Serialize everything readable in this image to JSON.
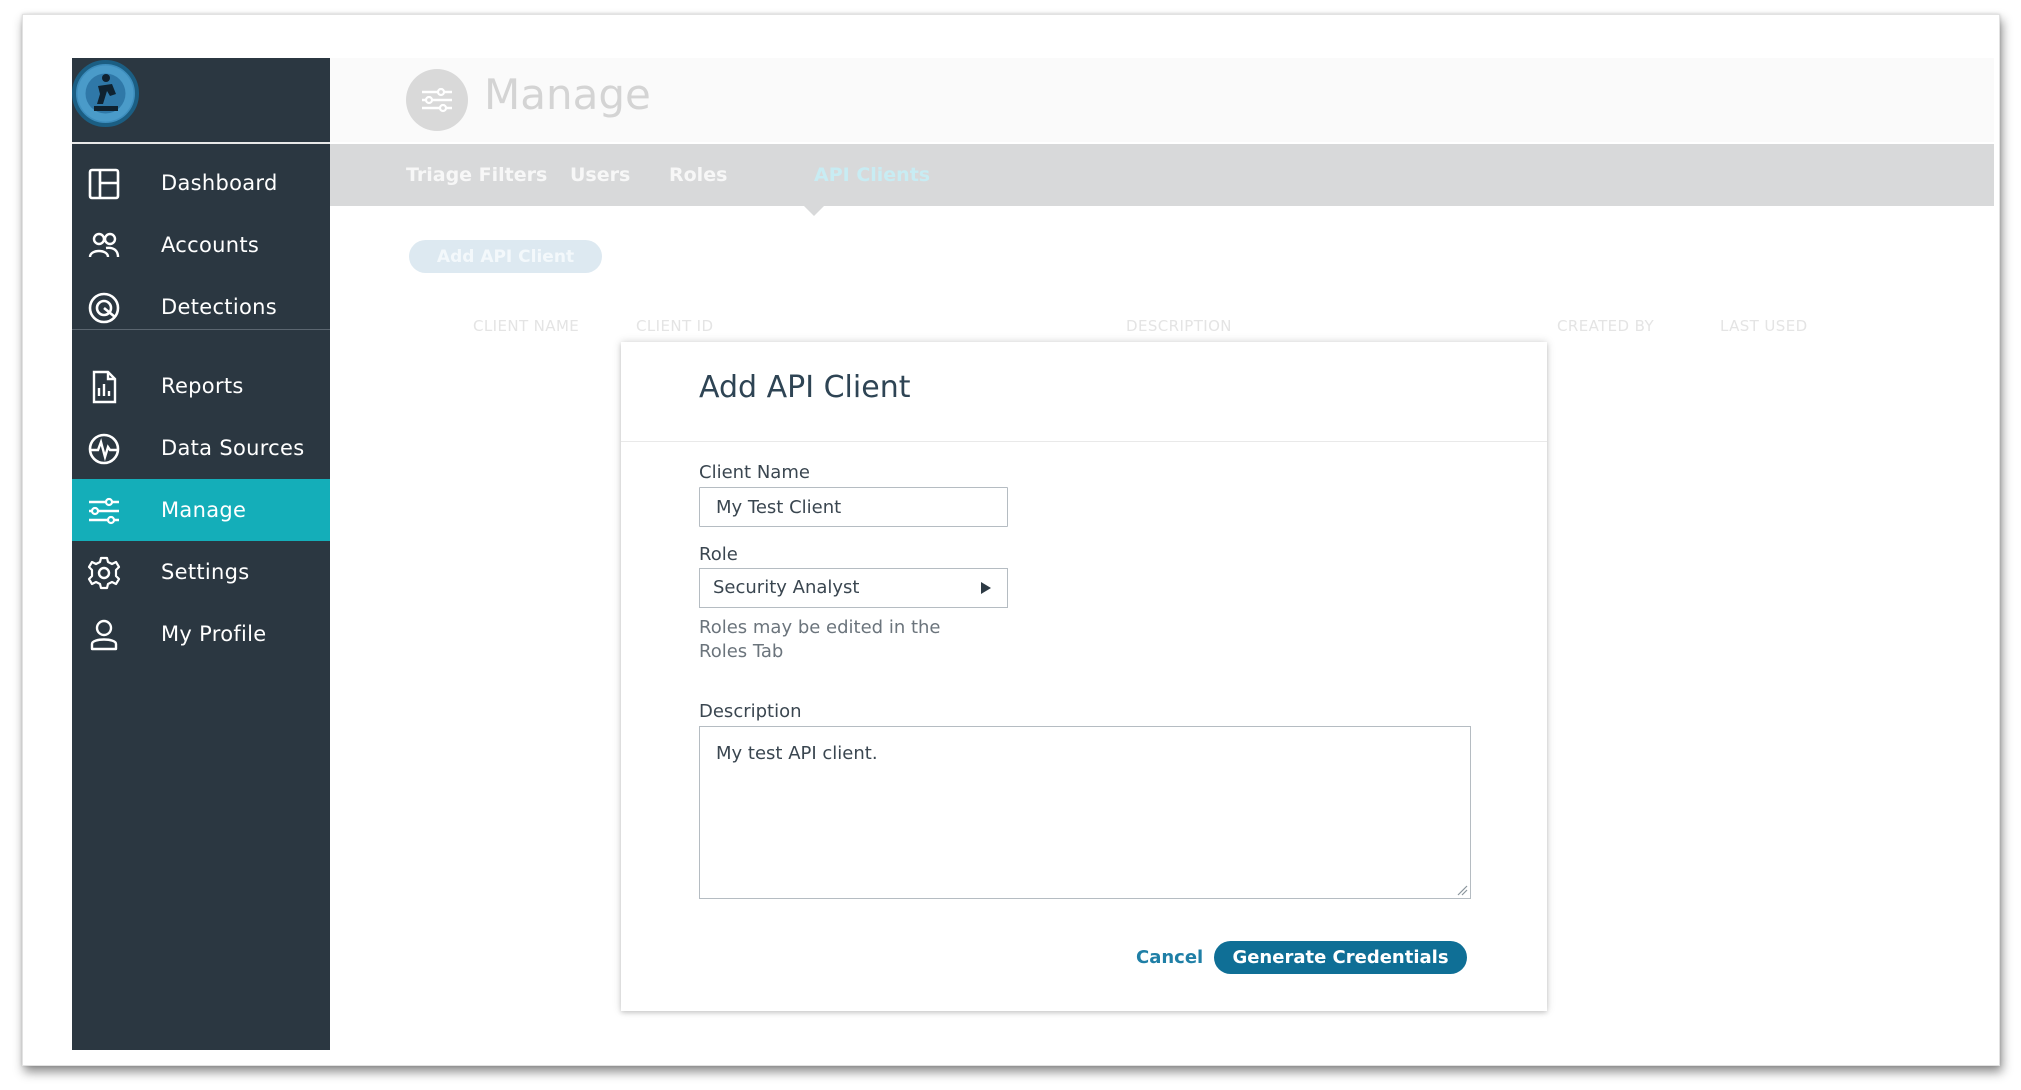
{
  "sidebar": {
    "items": [
      {
        "label": "Dashboard",
        "icon": "dashboard-icon"
      },
      {
        "label": "Accounts",
        "icon": "users-icon"
      },
      {
        "label": "Detections",
        "icon": "target-icon"
      },
      {
        "label": "Reports",
        "icon": "report-icon"
      },
      {
        "label": "Data Sources",
        "icon": "pulse-icon"
      },
      {
        "label": "Manage",
        "icon": "sliders-icon",
        "active": true
      },
      {
        "label": "Settings",
        "icon": "gear-icon"
      },
      {
        "label": "My Profile",
        "icon": "person-icon"
      }
    ]
  },
  "header": {
    "title": "Manage",
    "icon": "sliders-icon"
  },
  "tabs": [
    {
      "label": "Triage Filters"
    },
    {
      "label": "Users"
    },
    {
      "label": "Roles"
    },
    {
      "label": "API Clients",
      "active": true
    }
  ],
  "main": {
    "add_button_label": "Add API Client",
    "columns": [
      "CLIENT NAME",
      "CLIENT ID",
      "DESCRIPTION",
      "CREATED BY",
      "LAST USED"
    ]
  },
  "modal": {
    "title": "Add API Client",
    "client_name_label": "Client Name",
    "client_name_value": "My Test Client",
    "role_label": "Role",
    "role_value": "Security Analyst",
    "role_help": "Roles may be edited in the Roles Tab",
    "description_label": "Description",
    "description_value": "My test API client.",
    "cancel_label": "Cancel",
    "submit_label": "Generate Credentials"
  },
  "colors": {
    "sidebar_bg": "#2b3741",
    "active_accent": "#14aeb9",
    "primary_button": "#0f6f96",
    "link": "#1f7fa6"
  }
}
